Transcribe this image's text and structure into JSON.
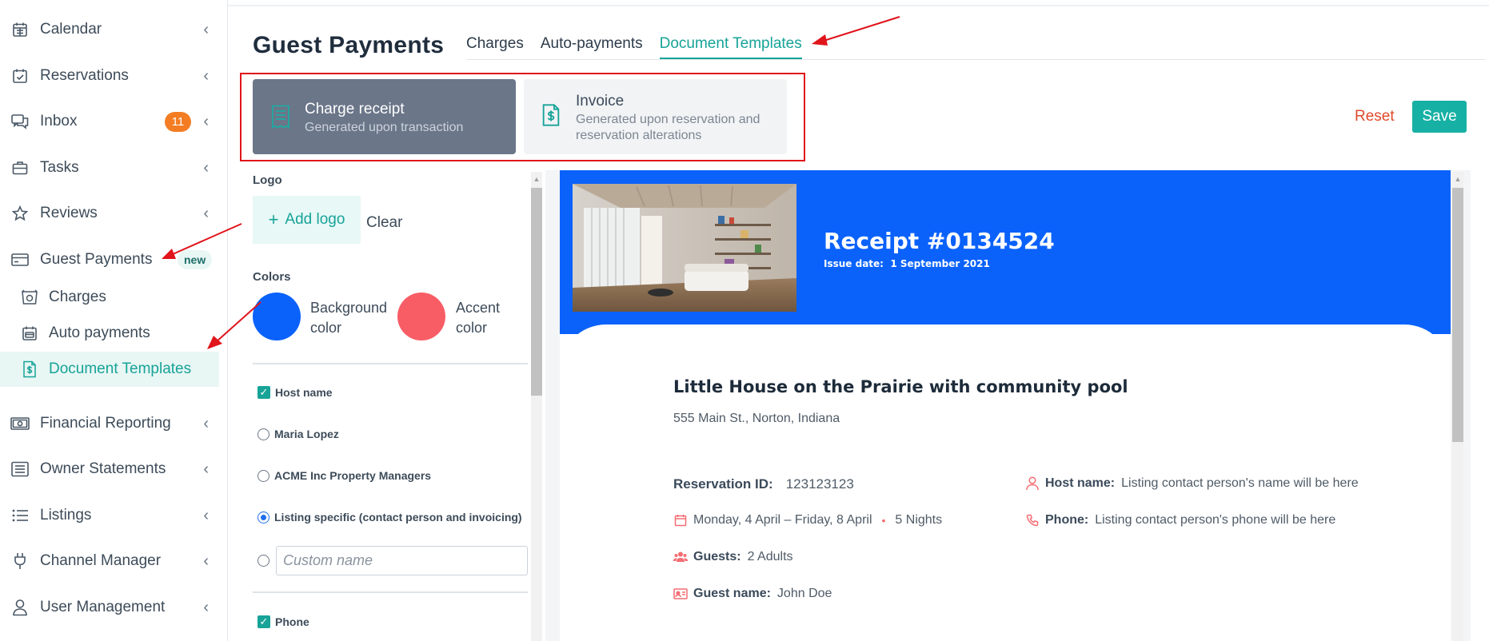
{
  "sidebar": {
    "items": [
      {
        "label": "Calendar",
        "icon": "calendar-icon"
      },
      {
        "label": "Reservations",
        "icon": "calendar-check-icon"
      },
      {
        "label": "Inbox",
        "icon": "chat-icon",
        "badge": "11"
      },
      {
        "label": "Tasks",
        "icon": "briefcase-icon"
      },
      {
        "label": "Reviews",
        "icon": "star-icon"
      },
      {
        "label": "Guest Payments",
        "icon": "credit-card-icon",
        "badge": "new"
      },
      {
        "label": "Financial Reporting",
        "icon": "money-icon"
      },
      {
        "label": "Owner Statements",
        "icon": "list-doc-icon"
      },
      {
        "label": "Listings",
        "icon": "list-icon"
      },
      {
        "label": "Channel Manager",
        "icon": "plug-icon"
      },
      {
        "label": "User Management",
        "icon": "user-icon"
      }
    ],
    "subitems": [
      {
        "label": "Charges",
        "icon": "receipt-icon"
      },
      {
        "label": "Auto payments",
        "icon": "calendar-card-icon"
      },
      {
        "label": "Document Templates",
        "icon": "dollar-document-icon"
      }
    ]
  },
  "header": {
    "title": "Guest Payments",
    "tabs": [
      "Charges",
      "Auto-payments",
      "Document Templates"
    ],
    "active_tab": "Document Templates"
  },
  "templates": [
    {
      "title": "Charge receipt",
      "subtitle": "Generated upon transaction",
      "icon": "receipt-doc-icon"
    },
    {
      "title": "Invoice",
      "subtitle": "Generated upon reservation and reservation alterations",
      "icon": "dollar-document-icon"
    }
  ],
  "actions": {
    "reset": "Reset",
    "save": "Save"
  },
  "settings": {
    "logo_label": "Logo",
    "add_logo": "Add logo",
    "clear": "Clear",
    "colors_label": "Colors",
    "background_color": {
      "label_1": "Background",
      "label_2": "color",
      "value": "#0a62fb"
    },
    "accent_color": {
      "label_1": "Accent",
      "label_2": "color",
      "value": "#f85d66"
    },
    "host_name_label": "Host name",
    "host_options": [
      "Maria Lopez",
      "ACME Inc Property Managers",
      "Listing specific (contact person and invoicing)"
    ],
    "selected_option": "Listing specific (contact person and invoicing)",
    "custom_name_placeholder": "Custom name",
    "phone_label": "Phone"
  },
  "preview": {
    "receipt_title": "Receipt #0134524",
    "issue_date_label": "Issue date:",
    "issue_date": "1 September 2021",
    "listing_name": "Little House on the Prairie with community pool",
    "address": "555 Main St., Norton, Indiana",
    "reservation_id_label": "Reservation ID:",
    "reservation_id": "123123123",
    "dates": "Monday, 4 April – Friday, 8 April",
    "nights": "5 Nights",
    "guests_label": "Guests:",
    "guests": "2 Adults",
    "guest_name_label": "Guest name:",
    "guest_name": "John Doe",
    "host_name_label": "Host name:",
    "host_name": "Listing contact person's name will be here",
    "phone_label": "Phone:",
    "phone": "Listing contact person's phone will be here"
  },
  "colors": {
    "accent": "#17a398",
    "brand_blue": "#0a62fb",
    "accent_red": "#f85d66",
    "annotation": "#e0141b"
  }
}
